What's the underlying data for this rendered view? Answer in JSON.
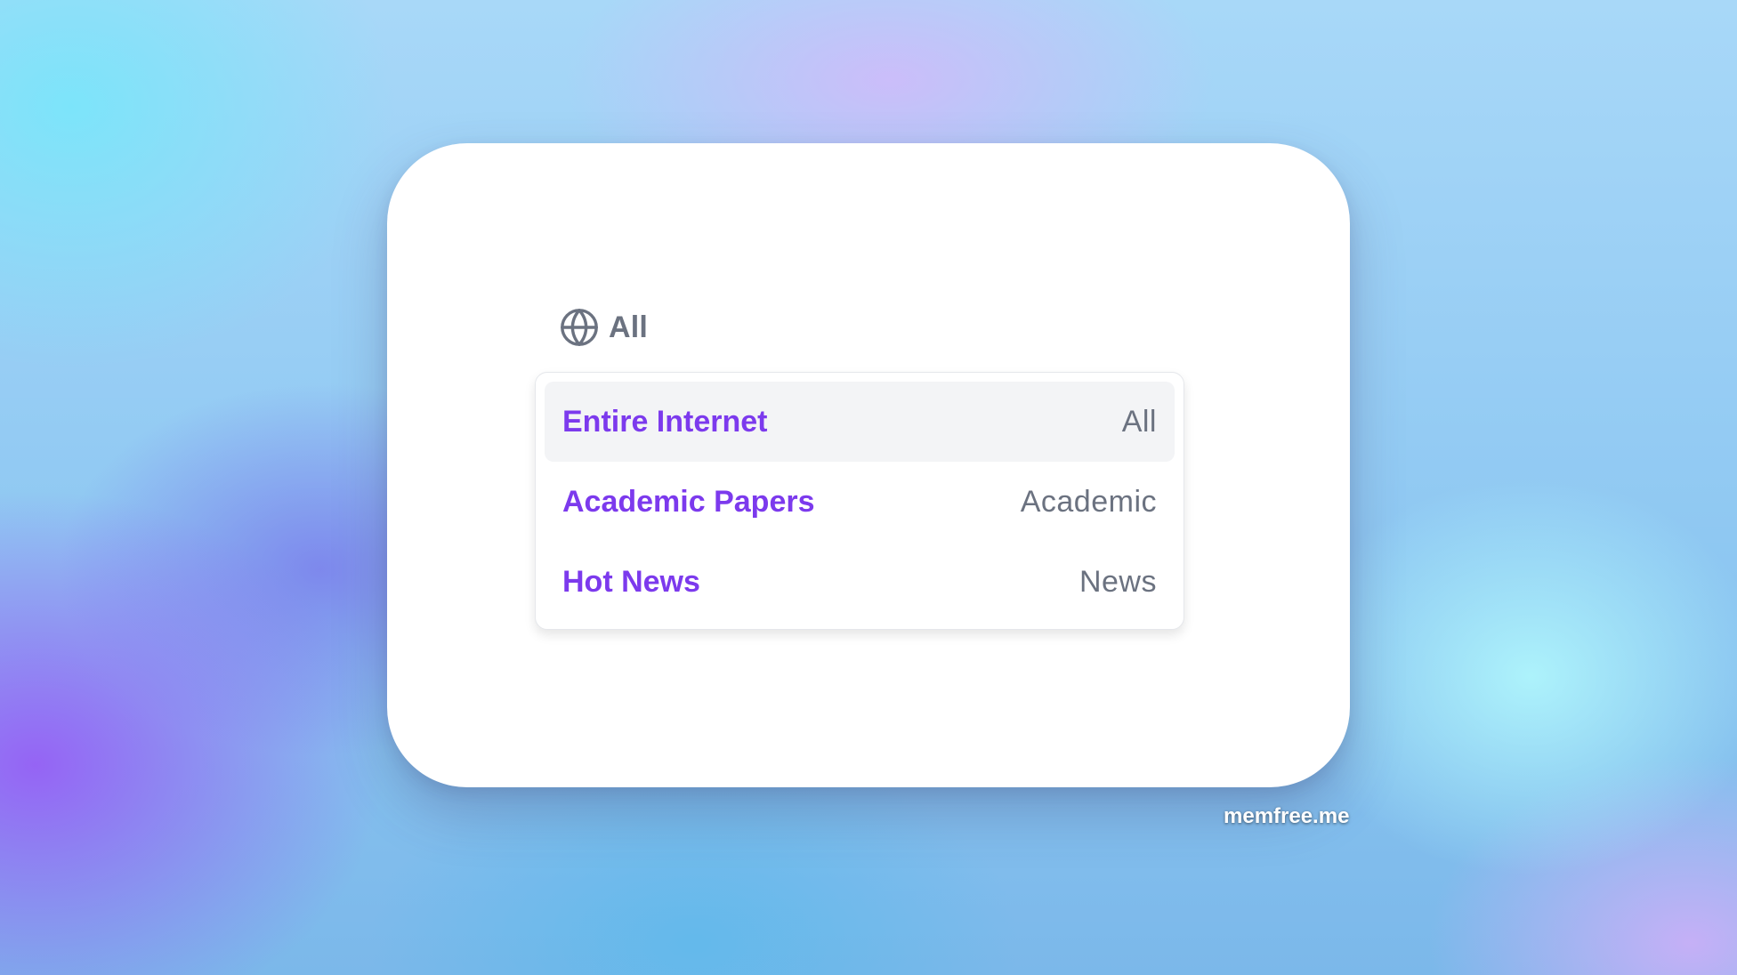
{
  "selector": {
    "current_label": "All",
    "icon": "globe-icon",
    "options": [
      {
        "label": "Entire Internet",
        "shortcut": "All",
        "highlighted": true
      },
      {
        "label": "Academic Papers",
        "shortcut": "Academic",
        "highlighted": false
      },
      {
        "label": "Hot News",
        "shortcut": "News",
        "highlighted": false
      }
    ]
  },
  "watermark": "memfree.me",
  "colors": {
    "option_label": "#7c3aed",
    "muted_text": "#6b7280",
    "highlight_bg": "#f3f4f6"
  }
}
